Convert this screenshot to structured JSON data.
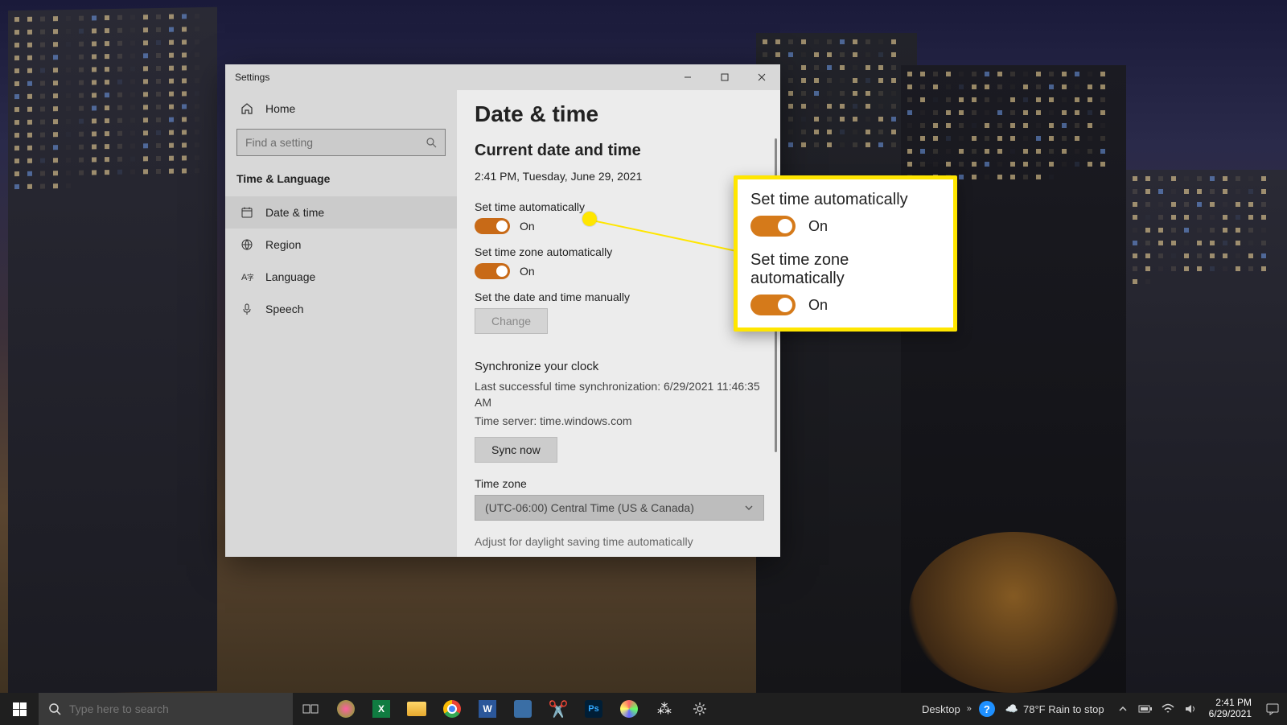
{
  "window": {
    "title": "Settings"
  },
  "sidebar": {
    "home": "Home",
    "search_placeholder": "Find a setting",
    "section": "Time & Language",
    "items": [
      {
        "label": "Date & time"
      },
      {
        "label": "Region"
      },
      {
        "label": "Language"
      },
      {
        "label": "Speech"
      }
    ]
  },
  "content": {
    "title": "Date & time",
    "current_heading": "Current date and time",
    "current_value": "2:41 PM, Tuesday, June 29, 2021",
    "auto_time_label": "Set time automatically",
    "auto_time_state": "On",
    "auto_tz_label": "Set time zone automatically",
    "auto_tz_state": "On",
    "manual_label": "Set the date and time manually",
    "change_button": "Change",
    "sync_heading": "Synchronize your clock",
    "sync_last": "Last successful time synchronization: 6/29/2021 11:46:35 AM",
    "sync_server": "Time server: time.windows.com",
    "sync_button": "Sync now",
    "tz_heading": "Time zone",
    "tz_value": "(UTC-06:00) Central Time (US & Canada)",
    "dst_label": "Adjust for daylight saving time automatically"
  },
  "callout": {
    "auto_time_label": "Set time automatically",
    "auto_time_state": "On",
    "auto_tz_label": "Set time zone automatically",
    "auto_tz_state": "On"
  },
  "taskbar": {
    "search_placeholder": "Type here to search",
    "desktop_label": "Desktop",
    "weather": "78°F Rain to stop",
    "time": "2:41 PM",
    "date": "6/29/2021"
  }
}
